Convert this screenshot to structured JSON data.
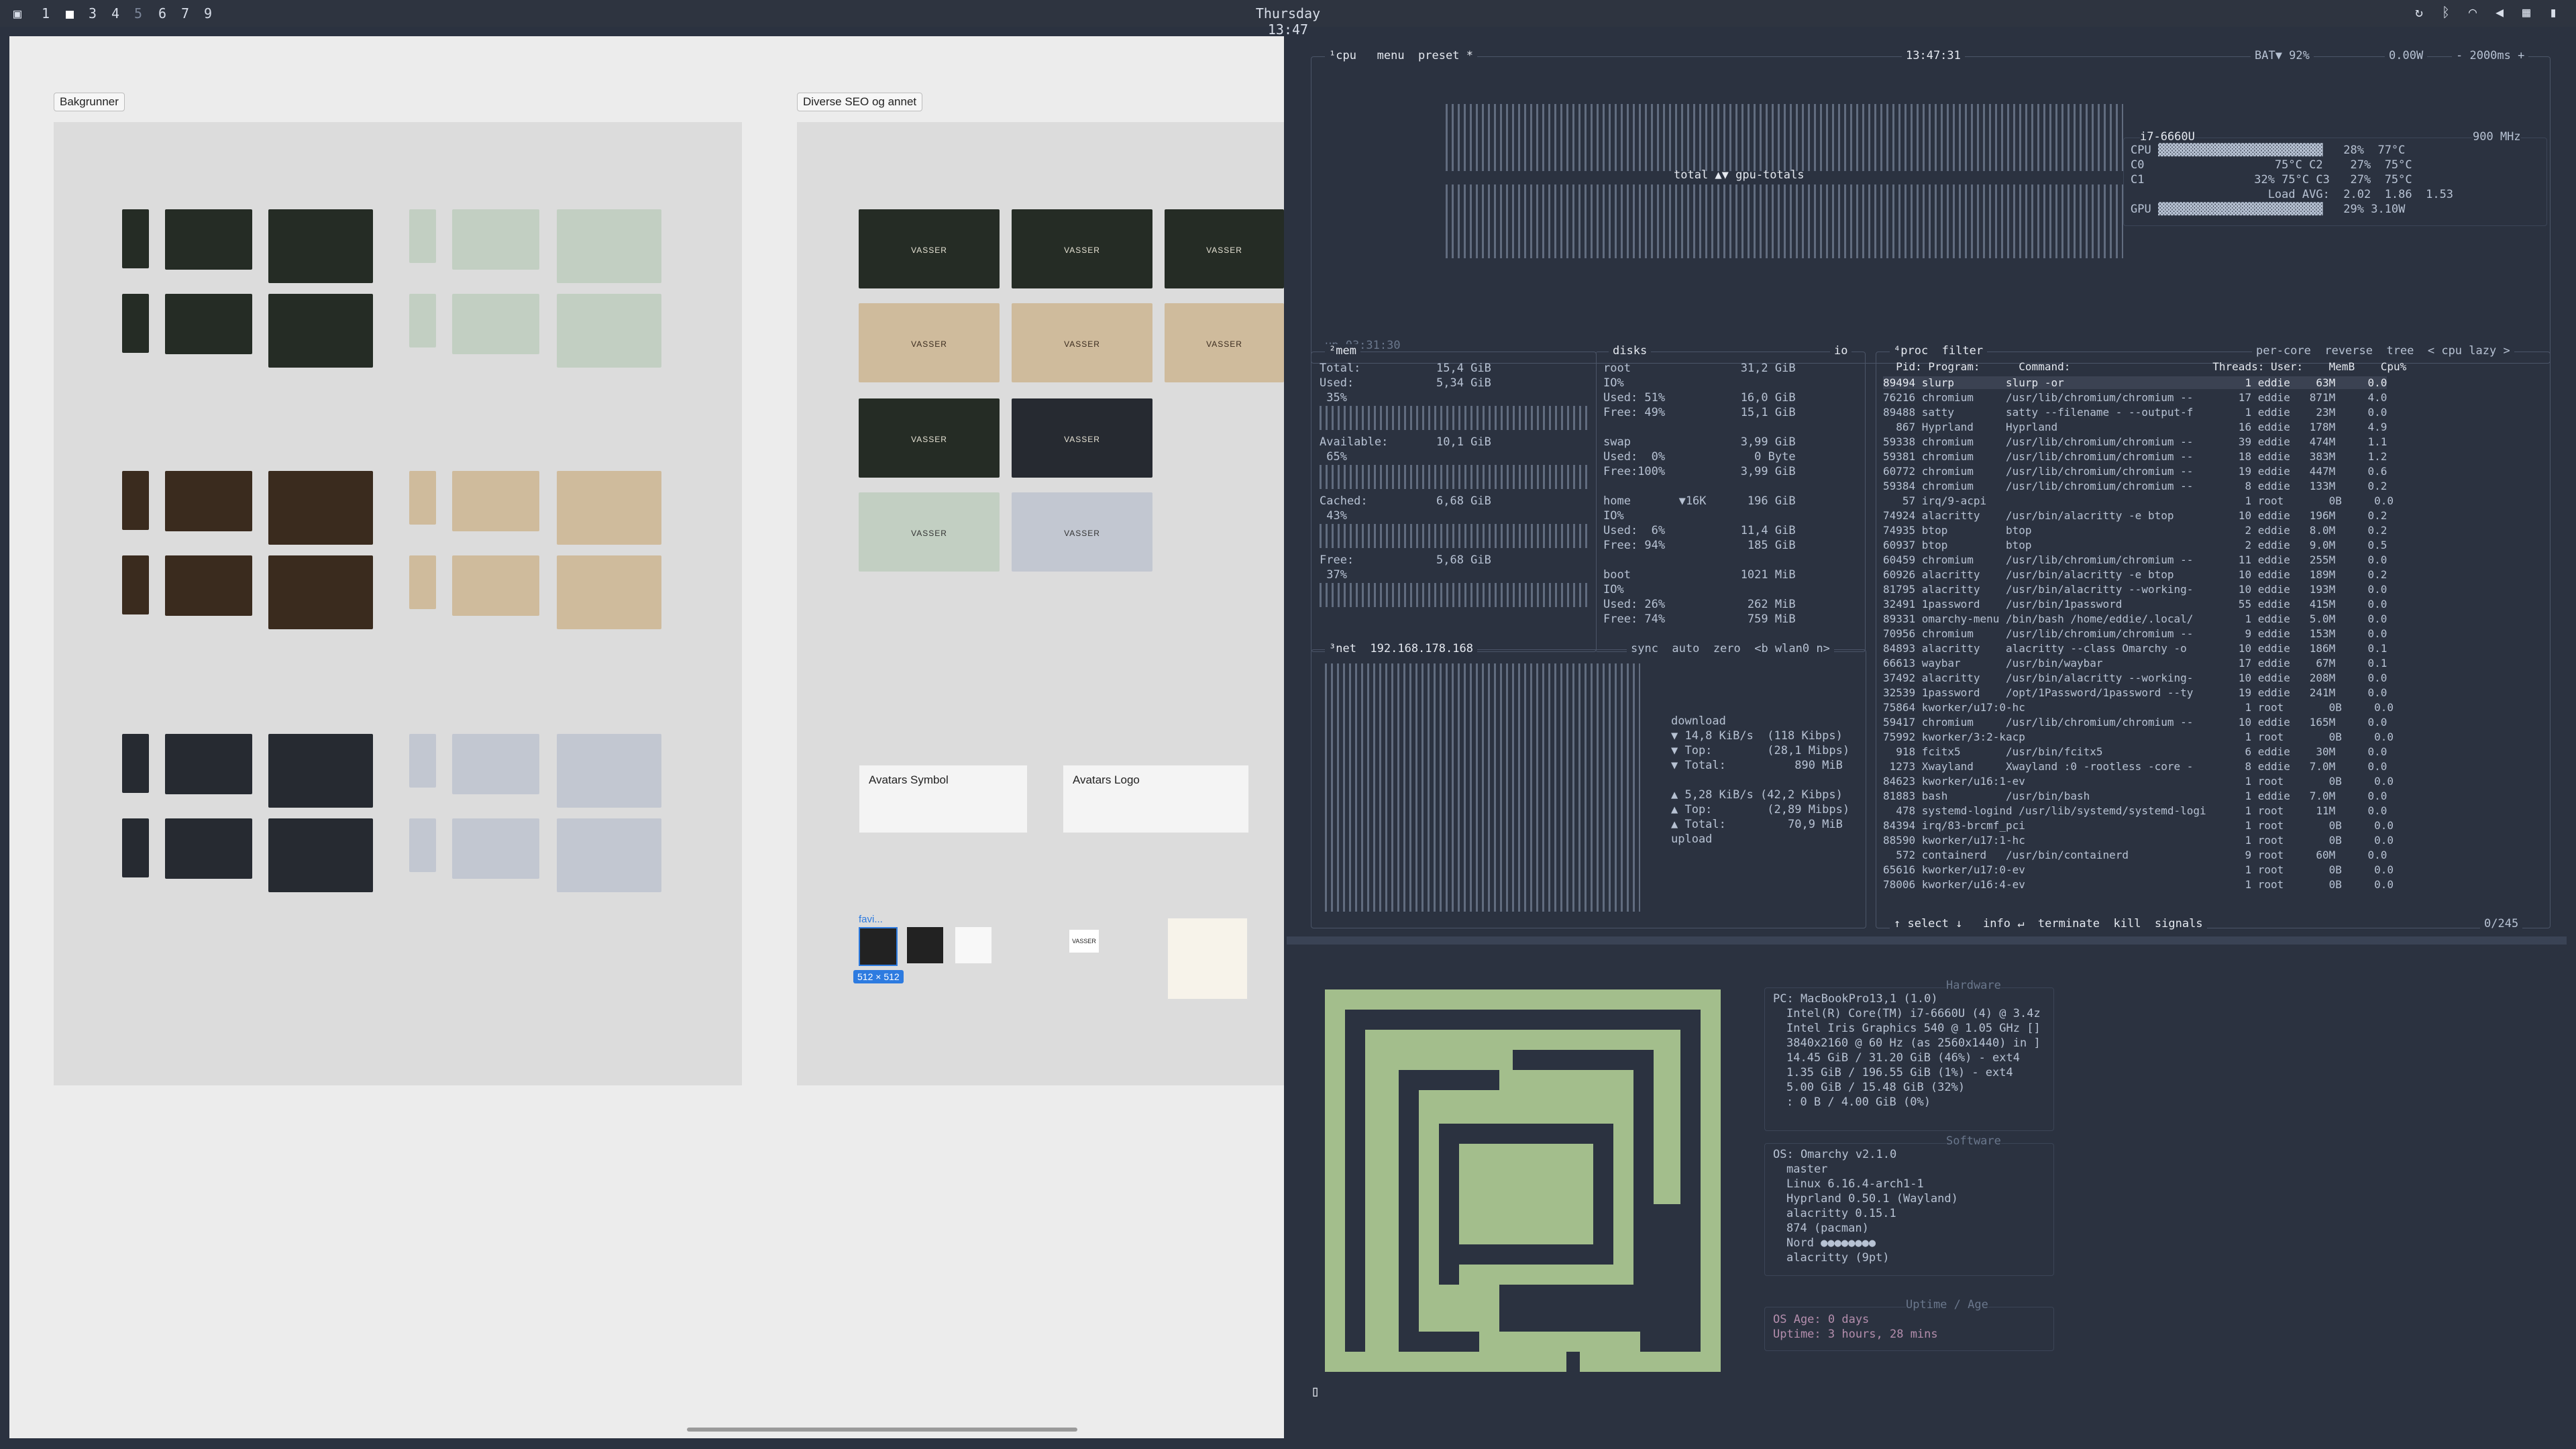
{
  "topbar": {
    "workspaces": [
      "1",
      "2",
      "3",
      "4",
      "5",
      "6",
      "7",
      "9"
    ],
    "clock": "Thursday 13:47",
    "tray_icons": [
      "bluetooth-icon",
      "wifi-icon",
      "volume-icon",
      "cpu-icon",
      "battery-icon"
    ]
  },
  "figma": {
    "frame1_label": "Bakgrunner",
    "frame2_label": "Diverse SEO og annet",
    "card_text": "VASSER",
    "avatars_symbol": "Avatars Symbol",
    "avatars_logo": "Avatars Logo",
    "favi_label": "favi...",
    "size_badge": "512 × 512",
    "vasser_small": "VASSER"
  },
  "btop": {
    "cpu_header": "¹cpu   menu  preset *",
    "time": "13:47:31",
    "battery": "BAT▼ 92%",
    "power": "0.00W",
    "interval": "- 2000ms +",
    "cpu_model": "i7-6660U",
    "cpu_freq": "900 MHz",
    "cpu_rows": [
      "CPU ▓▓▓▓▓▓▓▓▓▓▓▓▓▓▓▓▓▓▓▓▓▓▓▓   28%  77°C",
      "C0                   75°C C2    27%  75°C",
      "C1                32% 75°C C3   27%  75°C",
      "                    Load AVG:  2.02  1.86  1.53",
      "GPU ▓▓▓▓▓▓▓▓▓▓▓▓▓▓▓▓▓▓▓▓▓▓▓▓   29% 3.10W"
    ],
    "total_label": "total ▲▼ gpu-totals",
    "uptime_label": "up 03:31:30",
    "mem_header": "²mem",
    "mem_rows": [
      "Total:           15,4 GiB",
      "Used:            5,34 GiB",
      " 35%",
      "Available:       10,1 GiB",
      " 65%",
      "Cached:          6,68 GiB",
      " 43%",
      "Free:            5,68 GiB",
      " 37%"
    ],
    "disks_header": "disks",
    "io_label": "io",
    "disk_rows": [
      "root                31,2 GiB",
      "IO%",
      "Used: 51%           16,0 GiB",
      "Free: 49%           15,1 GiB",
      "swap                3,99 GiB",
      "Used:  0%             0 Byte",
      "Free:100%           3,99 GiB",
      "home       ▼16K      196 GiB",
      "IO%",
      "Used:  6%           11,4 GiB",
      "Free: 94%            185 GiB",
      "boot                1021 MiB",
      "IO%",
      "Used: 26%            262 MiB",
      "Free: 74%            759 MiB"
    ],
    "net_header": "³net  192.168.178.168",
    "net_controls": "sync  auto  zero  <b wlan0 n>",
    "net_rows": [
      "download",
      "▼ 14,8 KiB/s  (118 Kibps)",
      "▼ Top:        (28,1 Mibps)",
      "▼ Total:          890 MiB",
      "▲ 5,28 KiB/s (42,2 Kibps)",
      "▲ Top:        (2,89 Mibps)",
      "▲ Total:         70,9 MiB",
      "upload"
    ],
    "proc_header": "⁴proc  filter",
    "proc_controls": "per-core  reverse  tree  < cpu lazy >",
    "proc_cols": "  Pid: Program:      Command:                      Threads: User:    MemB    Cpu%",
    "proc_rows": [
      "89494 slurp        slurp -or                            1 eddie    63M     0.0",
      "76216 chromium     /usr/lib/chromium/chromium --       17 eddie   871M     4.0",
      "89488 satty        satty --filename - --output-f        1 eddie    23M     0.0",
      "  867 Hyprland     Hyprland                            16 eddie   178M     4.9",
      "59338 chromium     /usr/lib/chromium/chromium --       39 eddie   474M     1.1",
      "59381 chromium     /usr/lib/chromium/chromium --       18 eddie   383M     1.2",
      "60772 chromium     /usr/lib/chromium/chromium --       19 eddie   447M     0.6",
      "59384 chromium     /usr/lib/chromium/chromium --        8 eddie   133M     0.2",
      "   57 irq/9-acpi                                        1 root       0B     0.0",
      "74924 alacritty    /usr/bin/alacritty -e btop          10 eddie   196M     0.2",
      "74935 btop         btop                                 2 eddie   8.0M     0.2",
      "60937 btop         btop                                 2 eddie   9.0M     0.5",
      "60459 chromium     /usr/lib/chromium/chromium --       11 eddie   255M     0.0",
      "60926 alacritty    /usr/bin/alacritty -e btop          10 eddie   189M     0.2",
      "81795 alacritty    /usr/bin/alacritty --working-       10 eddie   193M     0.0",
      "32491 1password    /usr/bin/1password                  55 eddie   415M     0.0",
      "89331 omarchy-menu /bin/bash /home/eddie/.local/        1 eddie   5.0M     0.0",
      "70956 chromium     /usr/lib/chromium/chromium --        9 eddie   153M     0.0",
      "84893 alacritty    alacritty --class Omarchy -o        10 eddie   186M     0.1",
      "66613 waybar       /usr/bin/waybar                     17 eddie    67M     0.1",
      "37492 alacritty    /usr/bin/alacritty --working-       10 eddie   208M     0.0",
      "32539 1password    /opt/1Password/1password --ty       19 eddie   241M     0.0",
      "75864 kworker/u17:0-hc                                  1 root       0B     0.0",
      "59417 chromium     /usr/lib/chromium/chromium --       10 eddie   165M     0.0",
      "75992 kworker/3:2-kacp                                  1 root       0B     0.0",
      "  918 fcitx5       /usr/bin/fcitx5                      6 eddie    30M     0.0",
      " 1273 Xwayland     Xwayland :0 -rootless -core -        8 eddie   7.0M     0.0",
      "84623 kworker/u16:1-ev                                  1 root       0B     0.0",
      "81883 bash         /usr/bin/bash                        1 eddie   7.0M     0.0",
      "  478 systemd-logind /usr/lib/systemd/systemd-logi      1 root     11M     0.0",
      "84394 irq/83-brcmf_pci                                  1 root       0B     0.0",
      "88590 kworker/u17:1-hc                                  1 root       0B     0.0",
      "  572 containerd   /usr/bin/containerd                  9 root     60M     0.0",
      "65616 kworker/u17:0-ev                                  1 root       0B     0.0",
      "78006 kworker/u16:4-ev                                  1 root       0B     0.0"
    ],
    "proc_footer": "↑ select ↓   info ↵  terminate  kill  signals",
    "proc_count": "0/245"
  },
  "fastfetch": {
    "hardware_label": "Hardware",
    "hardware_rows": [
      "PC: MacBookPro13,1 (1.0)",
      "Intel(R) Core(TM) i7-6660U (4) @ 3.4z",
      "Intel Iris Graphics 540 @ 1.05 GHz []",
      "3840x2160 @ 60 Hz (as 2560x1440) in ]",
      "14.45 GiB / 31.20 GiB (46%) - ext4",
      "1.35 GiB / 196.55 GiB (1%) - ext4",
      "5.00 GiB / 15.48 GiB (32%)",
      ": 0 B / 4.00 GiB (0%)"
    ],
    "software_label": "Software",
    "software_rows": [
      "OS: Omarchy v2.1.0",
      "master",
      "Linux 6.16.4-arch1-1",
      "Hyprland 0.50.1 (Wayland)",
      "alacritty 0.15.1",
      "874 (pacman)",
      "Nord ●●●●●●●●",
      "alacritty (9pt)"
    ],
    "uptime_label": "Uptime / Age",
    "uptime_rows": [
      "OS Age: 0 days",
      "Uptime: 3 hours, 28 mins"
    ],
    "logo_color": "#a3be8c",
    "prompt": "▯"
  }
}
